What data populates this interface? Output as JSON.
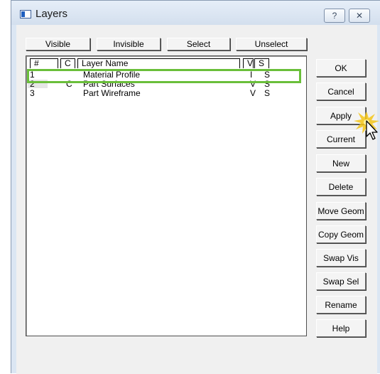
{
  "window": {
    "title": "Layers",
    "help_label": "?",
    "close_label": "✕"
  },
  "toolbar": {
    "visible_label": "Visible",
    "invisible_label": "Invisible",
    "select_label": "Select",
    "unselect_label": "Unselect"
  },
  "table": {
    "columns": [
      "#",
      "C",
      "Layer Name",
      "V",
      "S"
    ],
    "rows": [
      {
        "num": "1",
        "c": "",
        "name": "Material Profile",
        "v": "I",
        "s": "S"
      },
      {
        "num": "2",
        "c": "C",
        "name": "Part Surfaces",
        "v": "V",
        "s": "S"
      },
      {
        "num": "3",
        "c": "",
        "name": "Part Wireframe",
        "v": "V",
        "s": "S"
      }
    ]
  },
  "side_buttons": {
    "ok": "OK",
    "cancel": "Cancel",
    "apply": "Apply",
    "current": "Current",
    "new": "New",
    "delete": "Delete",
    "move_geom": "Move Geom",
    "copy_geom": "Copy Geom",
    "swap_vis": "Swap Vis",
    "swap_sel": "Swap Sel",
    "rename": "Rename",
    "help": "Help"
  },
  "colors": {
    "highlight": "#6abf3a",
    "click_burst": "#f5c518"
  },
  "icons": [
    "app-icon",
    "help-icon",
    "close-icon",
    "mouse-pointer-icon",
    "click-burst-icon"
  ]
}
